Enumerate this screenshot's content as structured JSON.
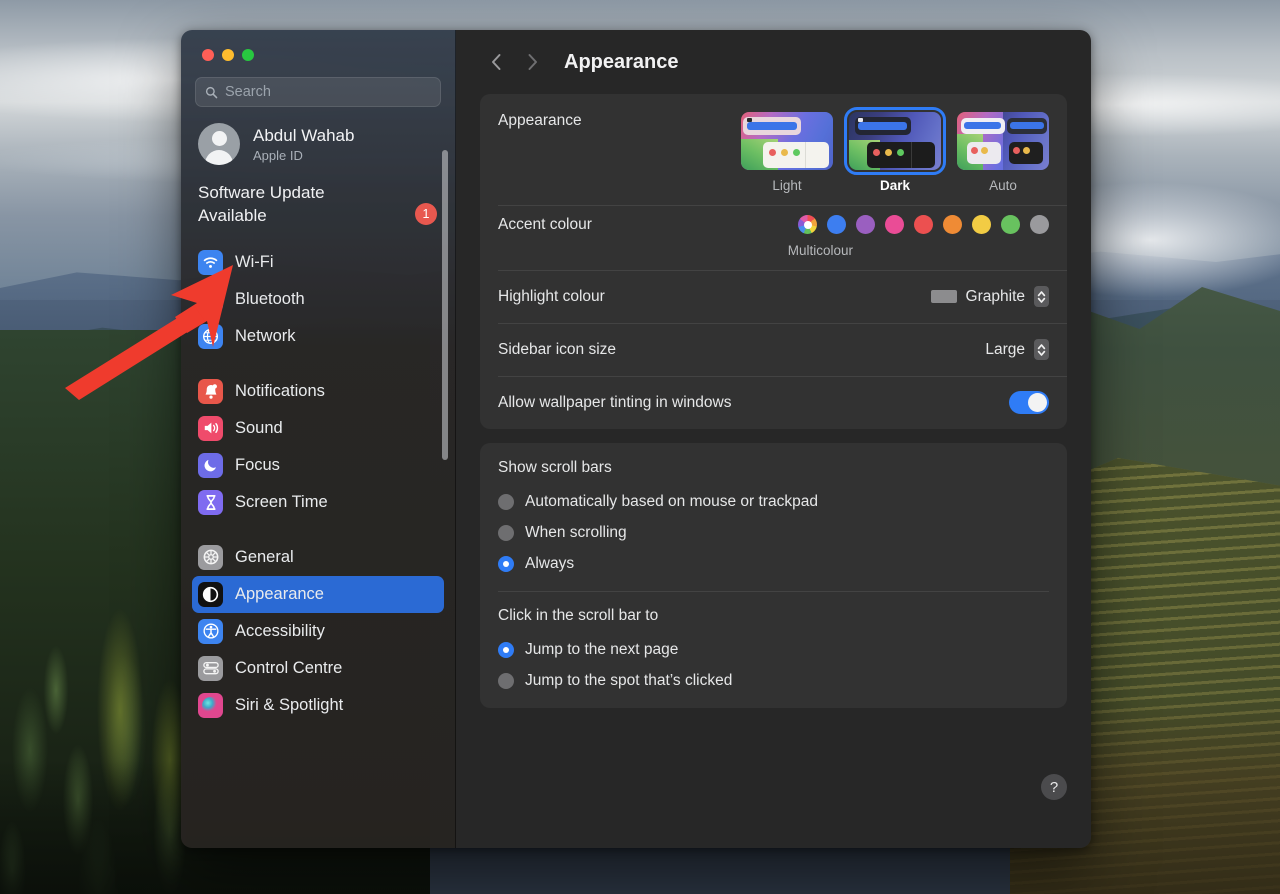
{
  "window": {
    "traffic_lights": [
      "close",
      "minimise",
      "zoom"
    ],
    "colors": {
      "accent_blue": "#2f7cf6",
      "selected_row": "#2b6ad4",
      "badge_red": "#e8584f",
      "card_bg": "#323232",
      "main_bg": "#272727"
    }
  },
  "sidebar": {
    "search": {
      "placeholder": "Search",
      "value": "",
      "icon": "search-icon"
    },
    "account": {
      "name": "Abdul Wahab",
      "subtitle": "Apple ID",
      "avatar_icon": "person-avatar-icon"
    },
    "update": {
      "text": "Software Update Available",
      "badge": "1"
    },
    "groups": [
      {
        "items": [
          {
            "label": "Wi-Fi",
            "icon": "wifi-icon",
            "color": "#3d84f0",
            "selected": false
          },
          {
            "label": "Bluetooth",
            "icon": "bluetooth-icon",
            "color": "#3d84f0",
            "selected": false
          },
          {
            "label": "Network",
            "icon": "globe-icon",
            "color": "#3d84f0",
            "selected": false
          }
        ]
      },
      {
        "items": [
          {
            "label": "Notifications",
            "icon": "bell-icon",
            "color": "#e8574a",
            "selected": false
          },
          {
            "label": "Sound",
            "icon": "speaker-icon",
            "color": "#ef4b6b",
            "selected": false
          },
          {
            "label": "Focus",
            "icon": "moon-icon",
            "color": "#6d6ce8",
            "selected": false
          },
          {
            "label": "Screen Time",
            "icon": "hourglass-icon",
            "color": "#7f6bf0",
            "selected": false
          }
        ]
      },
      {
        "items": [
          {
            "label": "General",
            "icon": "gear-icon",
            "color": "#9b9b9e",
            "selected": false
          },
          {
            "label": "Appearance",
            "icon": "appearance-icon",
            "color": "#111111",
            "selected": true
          },
          {
            "label": "Accessibility",
            "icon": "accessibility-icon",
            "color": "#3d84f0",
            "selected": false
          },
          {
            "label": "Control Centre",
            "icon": "control-centre-icon",
            "color": "#9b9b9e",
            "selected": false
          },
          {
            "label": "Siri & Spotlight",
            "icon": "siri-icon",
            "color": "#e0478f",
            "selected": false
          }
        ]
      }
    ]
  },
  "header": {
    "back_icon": "chevron-left-icon",
    "forward_icon": "chevron-right-icon",
    "title": "Appearance"
  },
  "main": {
    "appearance": {
      "label": "Appearance",
      "modes": [
        {
          "label": "Light",
          "selected": false
        },
        {
          "label": "Dark",
          "selected": true
        },
        {
          "label": "Auto",
          "selected": false
        }
      ]
    },
    "accent": {
      "label": "Accent colour",
      "caption": "Multicolour",
      "swatches": [
        {
          "name": "multicolour",
          "color": "multi",
          "selected": false
        },
        {
          "name": "blue",
          "color": "#3d7ef0",
          "selected": false
        },
        {
          "name": "purple",
          "color": "#9a5fc0",
          "selected": false
        },
        {
          "name": "pink",
          "color": "#ea4c96",
          "selected": false
        },
        {
          "name": "red",
          "color": "#ec5050",
          "selected": false
        },
        {
          "name": "orange",
          "color": "#ef8b35",
          "selected": false
        },
        {
          "name": "yellow",
          "color": "#f2cc44",
          "selected": false
        },
        {
          "name": "green",
          "color": "#68c25f",
          "selected": false
        },
        {
          "name": "graphite",
          "color": "#9a9a9d",
          "selected": false
        }
      ]
    },
    "highlight": {
      "label": "Highlight colour",
      "value": "Graphite",
      "swatch_color": "#8c8c8e"
    },
    "sidebar_icon_size": {
      "label": "Sidebar icon size",
      "value": "Large"
    },
    "wallpaper_tinting": {
      "label": "Allow wallpaper tinting in windows",
      "enabled": true
    },
    "scroll_bars": {
      "title": "Show scroll bars",
      "options": [
        {
          "label": "Automatically based on mouse or trackpad",
          "selected": false
        },
        {
          "label": "When scrolling",
          "selected": false
        },
        {
          "label": "Always",
          "selected": true
        }
      ]
    },
    "scroll_click": {
      "title": "Click in the scroll bar to",
      "options": [
        {
          "label": "Jump to the next page",
          "selected": true
        },
        {
          "label": "Jump to the spot that’s clicked",
          "selected": false
        }
      ]
    },
    "help": {
      "label": "?"
    }
  },
  "annotation": {
    "arrow": "red-arrow-pointing-to-software-update",
    "color": "#ef3b2d"
  }
}
